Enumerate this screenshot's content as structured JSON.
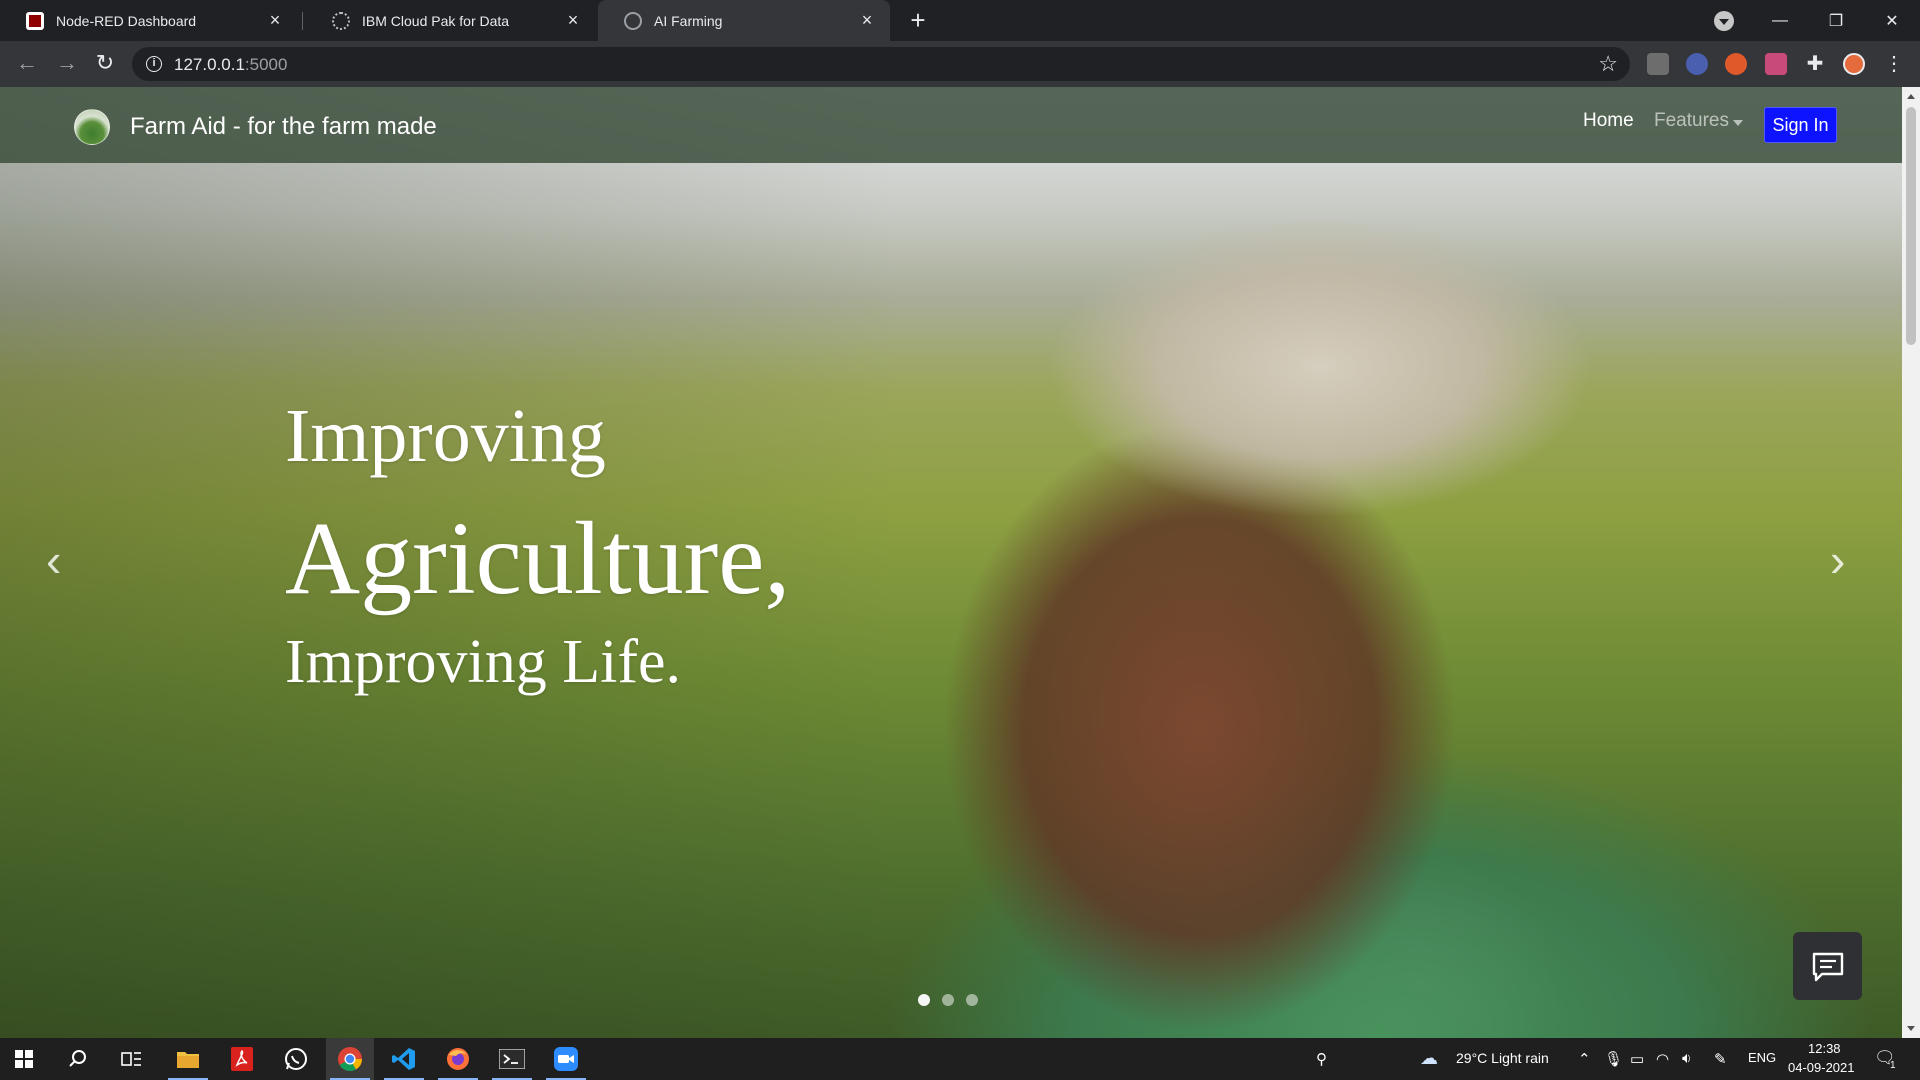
{
  "browser": {
    "tabs": [
      {
        "title": "Node-RED Dashboard",
        "active": false
      },
      {
        "title": "IBM Cloud Pak for Data",
        "active": false
      },
      {
        "title": "AI Farming",
        "active": true
      }
    ],
    "url_host": "127.0.0.1",
    "url_port": ":5000"
  },
  "page": {
    "brand": "Farm Aid - for the farm made",
    "nav": {
      "home": "Home",
      "features": "Features",
      "sign_in": "Sign In"
    },
    "hero": {
      "line1": "Improving",
      "line2": "Agriculture,",
      "line3": "Improving Life."
    },
    "carousel": {
      "slides": 3,
      "active_index": 0
    }
  },
  "taskbar": {
    "weather": "29°C  Light rain",
    "language": "ENG",
    "time": "12:38",
    "date": "04-09-2021",
    "notification_count": "1"
  },
  "colors": {
    "sign_in_button": "#0d12ff",
    "navbar": "#3e503e",
    "chrome_dark": "#202124"
  }
}
